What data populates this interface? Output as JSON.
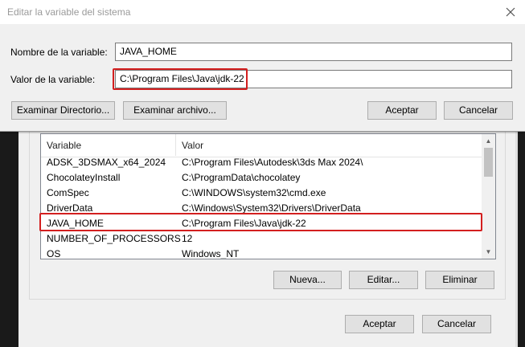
{
  "dialog": {
    "title": "Editar la variable del sistema",
    "name_label": "Nombre de la variable:",
    "name_value": "JAVA_HOME",
    "value_label": "Valor de la variable:",
    "value_value": "C:\\Program Files\\Java\\jdk-22",
    "browse_dir_button": "Examinar Directorio...",
    "browse_file_button": "Examinar archivo...",
    "accept_button": "Aceptar",
    "cancel_button": "Cancelar"
  },
  "system_vars": {
    "columns": [
      "Variable",
      "Valor"
    ],
    "rows": [
      {
        "name": "ADSK_3DSMAX_x64_2024",
        "value": "C:\\Program Files\\Autodesk\\3ds Max 2024\\"
      },
      {
        "name": "ChocolateyInstall",
        "value": "C:\\ProgramData\\chocolatey"
      },
      {
        "name": "ComSpec",
        "value": "C:\\WINDOWS\\system32\\cmd.exe"
      },
      {
        "name": "DriverData",
        "value": "C:\\Windows\\System32\\Drivers\\DriverData"
      },
      {
        "name": "JAVA_HOME",
        "value": "C:\\Program Files\\Java\\jdk-22"
      },
      {
        "name": "NUMBER_OF_PROCESSORS",
        "value": "12"
      },
      {
        "name": "OS",
        "value": "Windows_NT"
      }
    ],
    "new_button": "Nueva...",
    "edit_button": "Editar...",
    "delete_button": "Eliminar"
  },
  "env_dialog": {
    "accept_button": "Aceptar",
    "cancel_button": "Cancelar"
  },
  "colors": {
    "highlight": "#d31f1f",
    "dialog_bg": "#f0f0f0",
    "desktop_bg": "#1a1a1a"
  },
  "icons": {
    "close": "close-icon",
    "scroll_up": "chevron-up-icon",
    "scroll_down": "chevron-down-icon"
  }
}
